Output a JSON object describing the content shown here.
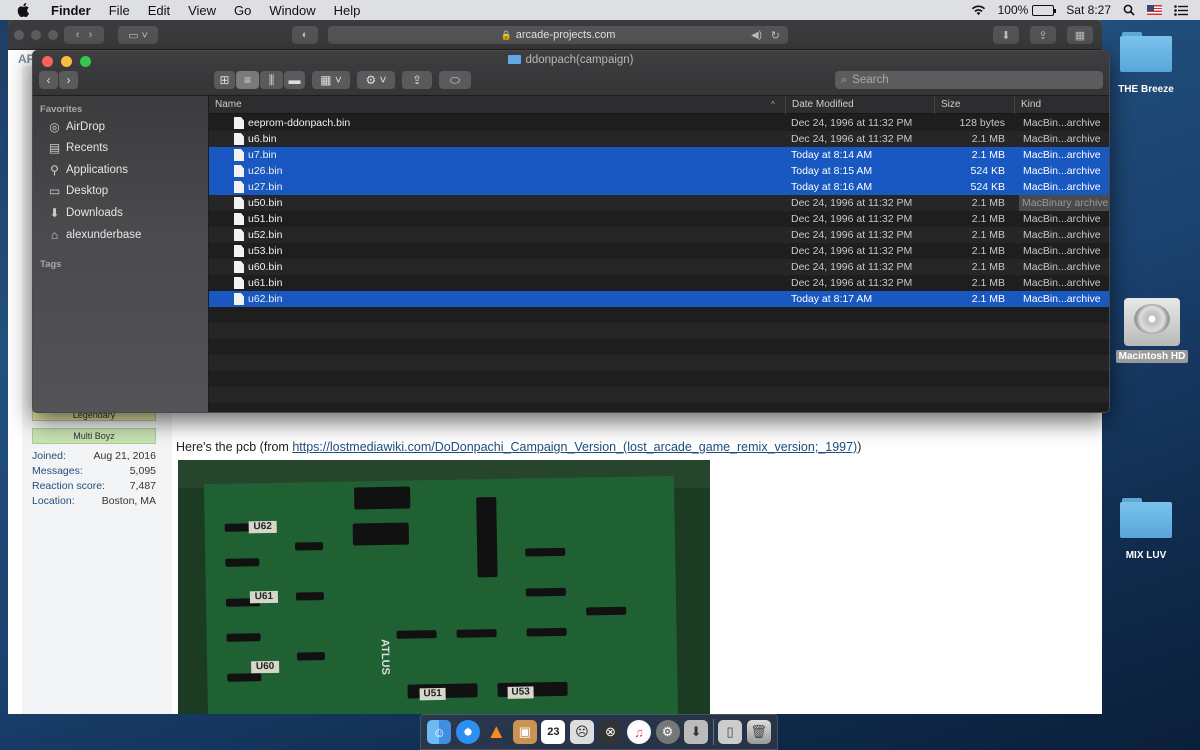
{
  "menubar": {
    "app_name": "Finder",
    "menus": [
      "File",
      "Edit",
      "View",
      "Go",
      "Window",
      "Help"
    ],
    "battery": "100%",
    "clock": "Sat 8:27"
  },
  "safari": {
    "url": "arcade-projects.com",
    "site_logo": "AP",
    "user_badges": [
      "Legendary",
      "Multi Boyz"
    ],
    "user_info": [
      {
        "label": "Joined:",
        "value": "Aug 21, 2016"
      },
      {
        "label": "Messages:",
        "value": "5,095"
      },
      {
        "label": "Reaction score:",
        "value": "7,487"
      },
      {
        "label": "Location:",
        "value": "Boston, MA"
      }
    ],
    "post_text": "Here's the pcb (from ",
    "post_link": "https://lostmediawiki.com/DoDonpachi_Campaign_Version_(lost_arcade_game_remix_version;_1997)",
    "post_text_end": ")",
    "pcb_labels": [
      "U62",
      "U61",
      "U60",
      "U51",
      "U53",
      "ATLUS"
    ]
  },
  "finder": {
    "title": "ddonpach(campaign)",
    "search_placeholder": "Search",
    "sidebar": {
      "favorites_header": "Favorites",
      "tags_header": "Tags",
      "items": [
        {
          "label": "AirDrop",
          "icon": "airdrop-icon"
        },
        {
          "label": "Recents",
          "icon": "recents-icon"
        },
        {
          "label": "Applications",
          "icon": "applications-icon"
        },
        {
          "label": "Desktop",
          "icon": "desktop-icon"
        },
        {
          "label": "Downloads",
          "icon": "downloads-icon"
        },
        {
          "label": "alexunderbase",
          "icon": "home-icon"
        }
      ]
    },
    "columns": {
      "name": "Name",
      "date": "Date Modified",
      "size": "Size",
      "kind": "Kind"
    },
    "files": [
      {
        "name": "eeprom-ddonpach.bin",
        "date": "Dec 24, 1996 at 11:32 PM",
        "size": "128 bytes",
        "kind": "MacBin...archive",
        "selected": false
      },
      {
        "name": "u6.bin",
        "date": "Dec 24, 1996 at 11:32 PM",
        "size": "2.1 MB",
        "kind": "MacBin...archive",
        "selected": false
      },
      {
        "name": "u7.bin",
        "date": "Today at 8:14 AM",
        "size": "2.1 MB",
        "kind": "MacBin...archive",
        "selected": true
      },
      {
        "name": "u26.bin",
        "date": "Today at 8:15 AM",
        "size": "524 KB",
        "kind": "MacBin...archive",
        "selected": true
      },
      {
        "name": "u27.bin",
        "date": "Today at 8:16 AM",
        "size": "524 KB",
        "kind": "MacBin...archive",
        "selected": true
      },
      {
        "name": "u50.bin",
        "date": "Dec 24, 1996 at 11:32 PM",
        "size": "2.1 MB",
        "kind": "MacBinary archive",
        "selected": false,
        "tooltip": true
      },
      {
        "name": "u51.bin",
        "date": "Dec 24, 1996 at 11:32 PM",
        "size": "2.1 MB",
        "kind": "MacBin...archive",
        "selected": false
      },
      {
        "name": "u52.bin",
        "date": "Dec 24, 1996 at 11:32 PM",
        "size": "2.1 MB",
        "kind": "MacBin...archive",
        "selected": false
      },
      {
        "name": "u53.bin",
        "date": "Dec 24, 1996 at 11:32 PM",
        "size": "2.1 MB",
        "kind": "MacBin...archive",
        "selected": false
      },
      {
        "name": "u60.bin",
        "date": "Dec 24, 1996 at 11:32 PM",
        "size": "2.1 MB",
        "kind": "MacBin...archive",
        "selected": false
      },
      {
        "name": "u61.bin",
        "date": "Dec 24, 1996 at 11:32 PM",
        "size": "2.1 MB",
        "kind": "MacBin...archive",
        "selected": false
      },
      {
        "name": "u62.bin",
        "date": "Today at 8:17 AM",
        "size": "2.1 MB",
        "kind": "MacBin...archive",
        "selected": true
      }
    ]
  },
  "desktop": {
    "icons": [
      "THE Breeze",
      "Macintosh HD",
      "MIX LUV"
    ]
  },
  "dock": {
    "apps": [
      "finder-icon",
      "safari-icon",
      "vlc-icon",
      "archive-utility-icon",
      "calendar-icon",
      "app-icon",
      "app-icon",
      "itunes-icon",
      "system-preferences-icon",
      "downloads-stack-icon",
      "documents-stack-icon",
      "trash-icon"
    ],
    "calendar_day": "23"
  }
}
